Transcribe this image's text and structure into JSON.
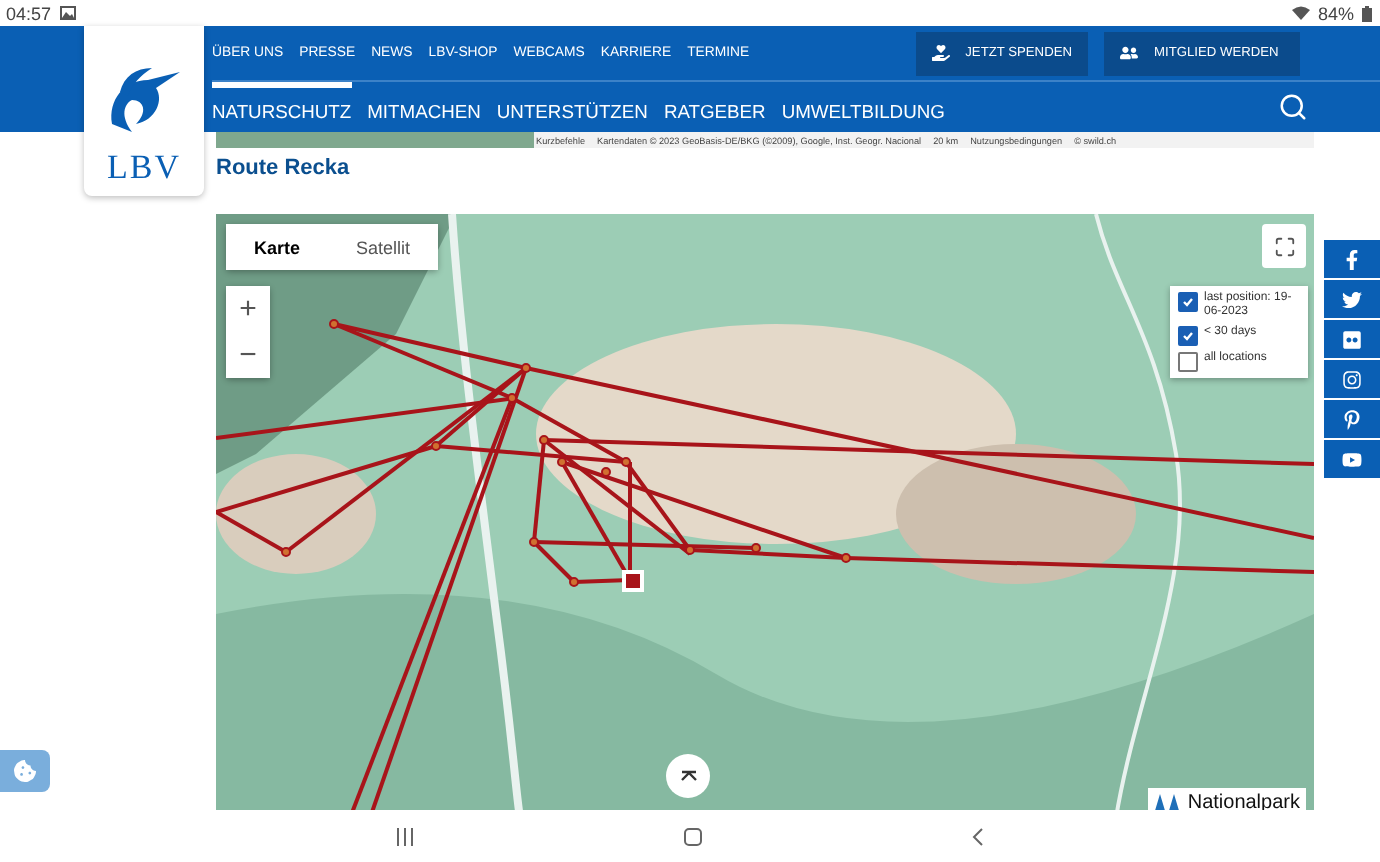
{
  "status_bar": {
    "time": "04:57",
    "battery": "84%"
  },
  "header": {
    "logo_text": "LBV",
    "top_links": [
      "ÜBER UNS",
      "PRESSE",
      "NEWS",
      "LBV-SHOP",
      "WEBCAMS",
      "KARRIERE",
      "TERMINE"
    ],
    "buttons": [
      {
        "label": "JETZT SPENDEN",
        "kind": "donate"
      },
      {
        "label": "MITGLIED WERDEN",
        "kind": "members"
      }
    ],
    "nav": [
      {
        "label": "NATURSCHUTZ",
        "selected": true
      },
      {
        "label": "MITMACHEN",
        "selected": false
      },
      {
        "label": "UNTERSTÜTZEN",
        "selected": false
      },
      {
        "label": "RATGEBER",
        "selected": false
      },
      {
        "label": "UMWELTBILDUNG",
        "selected": false
      }
    ]
  },
  "map_attribution": [
    "Kurzbefehle",
    "Kartendaten © 2023 GeoBasis-DE/BKG (©2009), Google, Inst. Geogr. Nacional",
    "20 km",
    "Nutzungsbedingungen",
    "© swild.ch"
  ],
  "page_title": "Route Recka",
  "map": {
    "map_types": [
      {
        "label": "Karte",
        "selected": true
      },
      {
        "label": "Satellit",
        "selected": false
      }
    ],
    "zoom_in": "+",
    "zoom_out": "−",
    "legend": [
      {
        "label": "last position: 19-06-2023",
        "checked": true
      },
      {
        "label": "< 30 days",
        "checked": true
      },
      {
        "label": "all locations",
        "checked": false
      }
    ],
    "logo_text": "Nationalpark"
  }
}
